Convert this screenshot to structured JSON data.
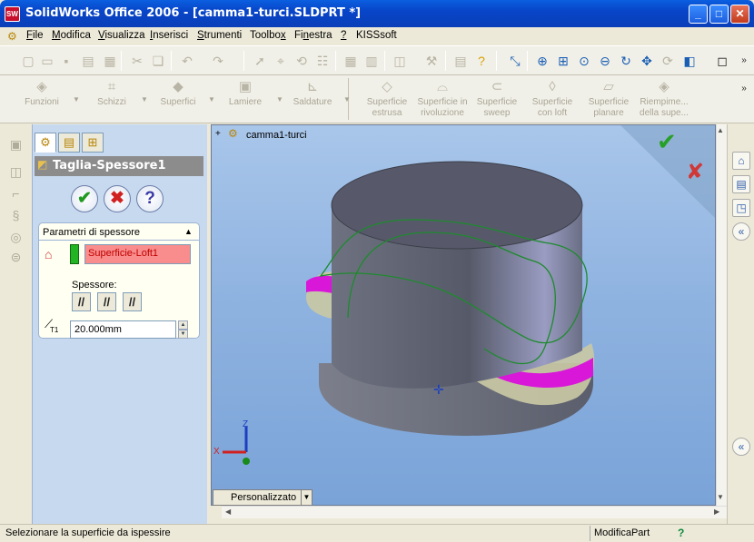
{
  "window": {
    "title": "SolidWorks Office 2006 - [camma1-turci.SLDPRT *]",
    "app_icon": "SW",
    "min": "_",
    "max": "□",
    "close": "✕"
  },
  "menu": [
    {
      "label": "File",
      "u": "F"
    },
    {
      "label": "Modifica",
      "u": "M"
    },
    {
      "label": "Visualizza",
      "u": "V"
    },
    {
      "label": "Inserisci",
      "u": "I"
    },
    {
      "label": "Strumenti",
      "u": "S"
    },
    {
      "label": "Toolbox",
      "u": "x"
    },
    {
      "label": "Finestra",
      "u": "n"
    },
    {
      "label": "?",
      "u": "?"
    },
    {
      "label": "KISSsoft",
      "u": ""
    }
  ],
  "command_manager": {
    "groups": [
      "Funzioni",
      "Schizzi",
      "Superfici",
      "Lamiere",
      "Saldature"
    ],
    "tools": [
      {
        "line1": "Superficie",
        "line2": "estrusa"
      },
      {
        "line1": "Superficie in",
        "line2": "rivoluzione"
      },
      {
        "line1": "Superficie",
        "line2": "sweep"
      },
      {
        "line1": "Superficie",
        "line2": "con loft"
      },
      {
        "line1": "Superficie",
        "line2": "planare"
      },
      {
        "line1": "Riempime...",
        "line2": "della supe..."
      }
    ]
  },
  "property_manager": {
    "feature_name": "Taglia-Spessore1",
    "group_title": "Parametri di spessore",
    "selection": "Superficie-Loft1",
    "thickness_label": "Spessore:",
    "thickness_value": "20.000mm",
    "t1_label": "T1"
  },
  "viewport": {
    "tree_item": "camma1-turci",
    "expand": "+",
    "triad": {
      "x": "X",
      "y": "Y",
      "z": "Z"
    },
    "view_menu": "Personalizzato"
  },
  "status": {
    "message": "Selezionare la superficie da ispessire",
    "mode": "ModificaPart"
  }
}
